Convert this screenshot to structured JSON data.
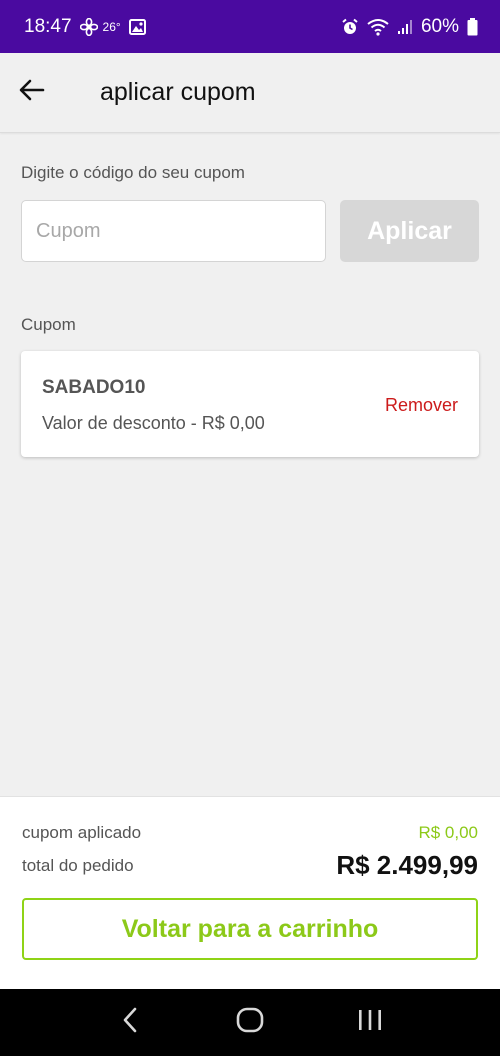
{
  "status_bar": {
    "time": "18:47",
    "temperature": "26°",
    "battery": "60%",
    "icons": [
      "fan-icon",
      "image-icon",
      "alarm-icon",
      "wifi-icon",
      "signal-icon",
      "battery-icon"
    ],
    "background_color": "#4a0aa0"
  },
  "header": {
    "title": "aplicar cupom",
    "back_icon": "arrow-left-icon"
  },
  "coupon_form": {
    "prompt": "Digite o código do seu cupom",
    "input_value": "",
    "input_placeholder": "Cupom",
    "apply_label": "Aplicar"
  },
  "applied_coupon": {
    "section_label": "Cupom",
    "code": "SABADO10",
    "discount_text": "Valor de desconto - R$ 0,00",
    "remove_label": "Remover"
  },
  "summary": {
    "applied_label": "cupom aplicado",
    "applied_value": "R$ 0,00",
    "total_label": "total do pedido",
    "total_value": "R$ 2.499,99",
    "back_button_label": "Voltar para a carrinho"
  },
  "nav_bar": {
    "icons": [
      "back-icon",
      "home-icon",
      "recent-apps-icon"
    ]
  },
  "colors": {
    "accent_green": "#8cc919",
    "remove_red": "#cc1b1b",
    "disabled_button": "#d7d7d7"
  }
}
